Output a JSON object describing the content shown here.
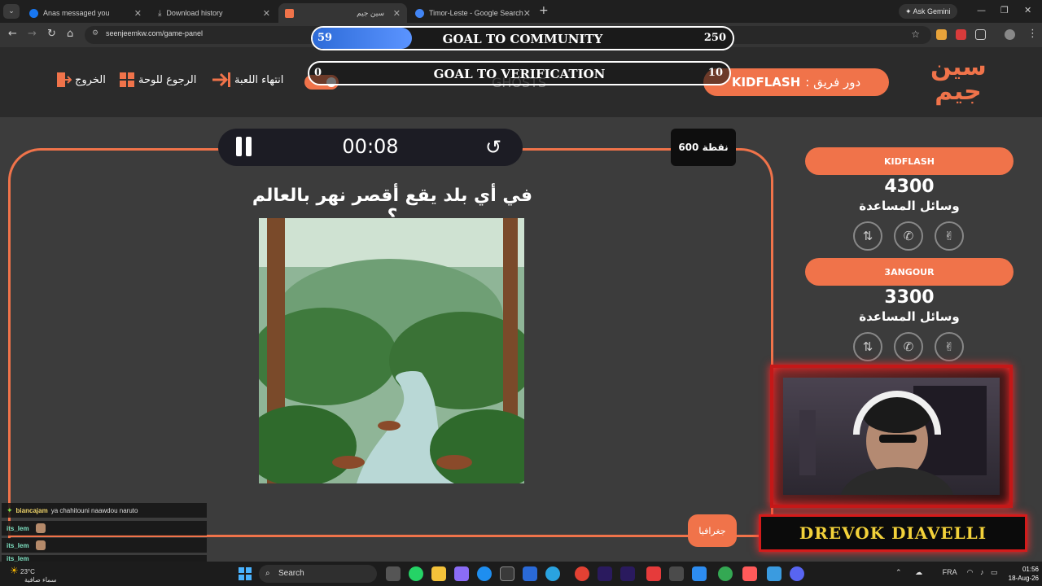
{
  "browser": {
    "tabs": [
      {
        "label": "Anas messaged you",
        "color": "#1877f2"
      },
      {
        "label": "Download history",
        "color": "#888888"
      },
      {
        "label": "سين جيم",
        "color": "#f0734a"
      },
      {
        "label": "Timor-Leste - Google Search",
        "color": "#4285f4"
      }
    ],
    "url": "seenjeemkw.com/game-panel",
    "ask_gemini": "Ask Gemini"
  },
  "header": {
    "exit_label": "الخروج",
    "back_to_board_label": "الرجوع للوحة",
    "end_game_label": "انتهاء اللعبة",
    "team_turn_prefix": "دور فريق :",
    "team_turn_name": "KIDFLASH",
    "logo_text_top": "سين",
    "logo_text_bottom": "جيم",
    "accent": "#f0734a"
  },
  "goals": {
    "community": {
      "title": "GOAL TO COMMUNITY",
      "current": "59",
      "target": "250",
      "progress": 0.236
    },
    "verification": {
      "title": "GOAL TO VERIFICATION",
      "current": "0",
      "target": "10",
      "progress": 0
    }
  },
  "overlay_ghost_text": "GHOSTS",
  "timer": {
    "time": "00:08"
  },
  "points_label": "600 نقطة",
  "question": "في أي بلد يقع أقصر نهر بالعالم ؟",
  "category": "جغرافيا",
  "teams": [
    {
      "name": "KIDFLASH",
      "score": "4300",
      "aids_label": "وسائل المساعدة"
    },
    {
      "name": "3ANGOUR",
      "score": "3300",
      "aids_label": "وسائل المساعدة"
    }
  ],
  "streamer": {
    "name": "DREVOK DIAVELLI"
  },
  "chat": [
    {
      "user": "biancajam",
      "msg": "ya chahitouni naawdou naruto"
    },
    {
      "user": "its_lem",
      "msg": ""
    },
    {
      "user": "its_lem",
      "msg": ""
    },
    {
      "user": "its_lem",
      "msg": ""
    }
  ],
  "taskbar": {
    "weather_temp": "23°C",
    "weather_desc": "سماء صافية",
    "search": "Search",
    "lang": "FRA",
    "time": "01:56",
    "date": "18-Aug-26"
  }
}
